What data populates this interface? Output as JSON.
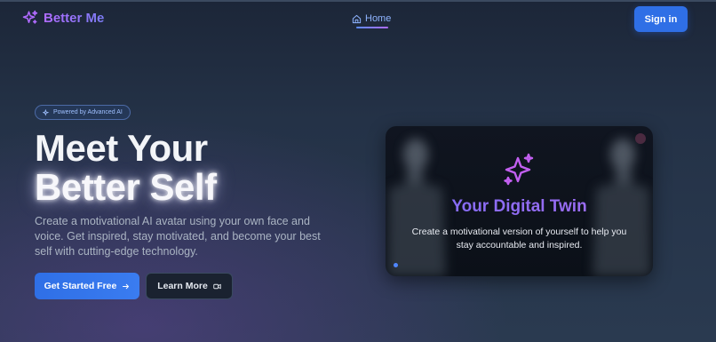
{
  "brand": {
    "name": "Better Me",
    "icon": "sparkles-icon",
    "gradient": [
      "#b06bff",
      "#7c7cf5"
    ]
  },
  "nav": {
    "home_label": "Home",
    "home_icon": "home-icon",
    "signin_label": "Sign in"
  },
  "hero": {
    "badge": "Powered by Advanced AI",
    "badge_icon": "sparkles-icon",
    "title_line1": "Meet Your",
    "title_line2": "Better Self",
    "description": "Create a motivational AI avatar using your own face and voice. Get inspired, stay motivated, and become your best self with cutting-edge technology.",
    "primary_button": "Get Started Free",
    "primary_icon": "arrow-right-icon",
    "secondary_button": "Learn More",
    "secondary_icon": "video-icon"
  },
  "card": {
    "title": "Your Digital Twin",
    "description": "Create a motivational version of yourself to help you stay accountable and inspired.",
    "icon": "sparkles-icon"
  },
  "colors": {
    "accent": "#2f6fe6",
    "purple": "#a36bf2",
    "background": "#243247"
  }
}
